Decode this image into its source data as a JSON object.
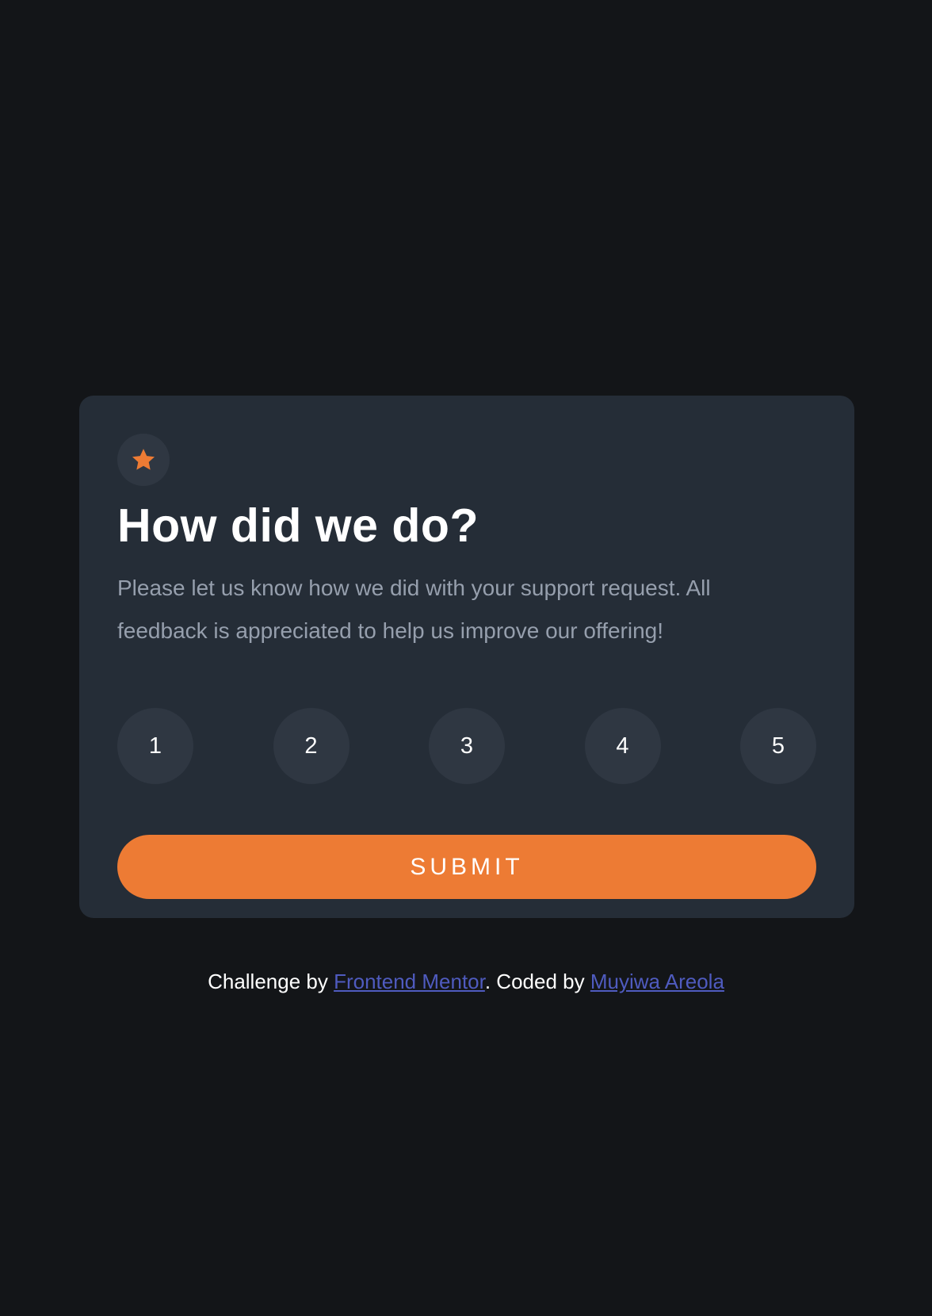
{
  "card": {
    "icon": "star-icon",
    "title": "How did we do?",
    "description": "Please let us know how we did with your support request. All feedback is appreciated to help us improve our offering!",
    "ratings": [
      "1",
      "2",
      "3",
      "4",
      "5"
    ],
    "submit_label": "SUBMIT"
  },
  "footer": {
    "prefix": "Challenge by ",
    "link1": "Frontend Mentor",
    "middle": ". Coded by ",
    "link2": "Muyiwa Areola"
  },
  "colors": {
    "background": "#131518",
    "card": "#252d37",
    "circle": "#2f3742",
    "accent": "#ed7b34",
    "link": "#4f5bbf",
    "muted_text": "#969fad"
  }
}
